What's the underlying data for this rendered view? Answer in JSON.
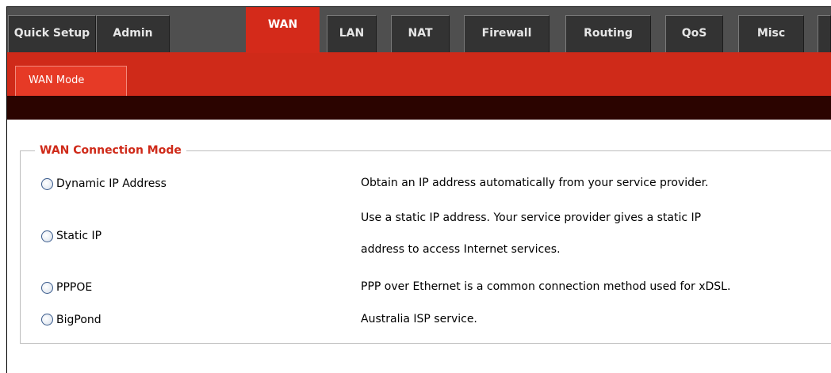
{
  "nav": {
    "tabs": [
      "Quick Setup",
      "Admin",
      "WAN",
      "LAN",
      "NAT",
      "Firewall",
      "Routing",
      "QoS",
      "Misc"
    ],
    "active": "WAN"
  },
  "subnav": {
    "tab": "WAN Mode"
  },
  "colors": {
    "accent": "#cf2a19",
    "nav_bg": "#333333",
    "dark_bar": "#2b0400"
  },
  "wan_mode": {
    "legend": "WAN Connection Mode",
    "options": [
      {
        "label": "Dynamic IP Address",
        "description": "Obtain an IP address automatically from your service provider."
      },
      {
        "label": "Static IP",
        "description_line1": "Use a static IP address. Your service provider gives a static IP",
        "description_line2": "address to access Internet services."
      },
      {
        "label": "PPPOE",
        "description": "PPP over Ethernet is a common connection method used for xDSL."
      },
      {
        "label": "BigPond",
        "description": "Australia ISP service."
      }
    ]
  }
}
